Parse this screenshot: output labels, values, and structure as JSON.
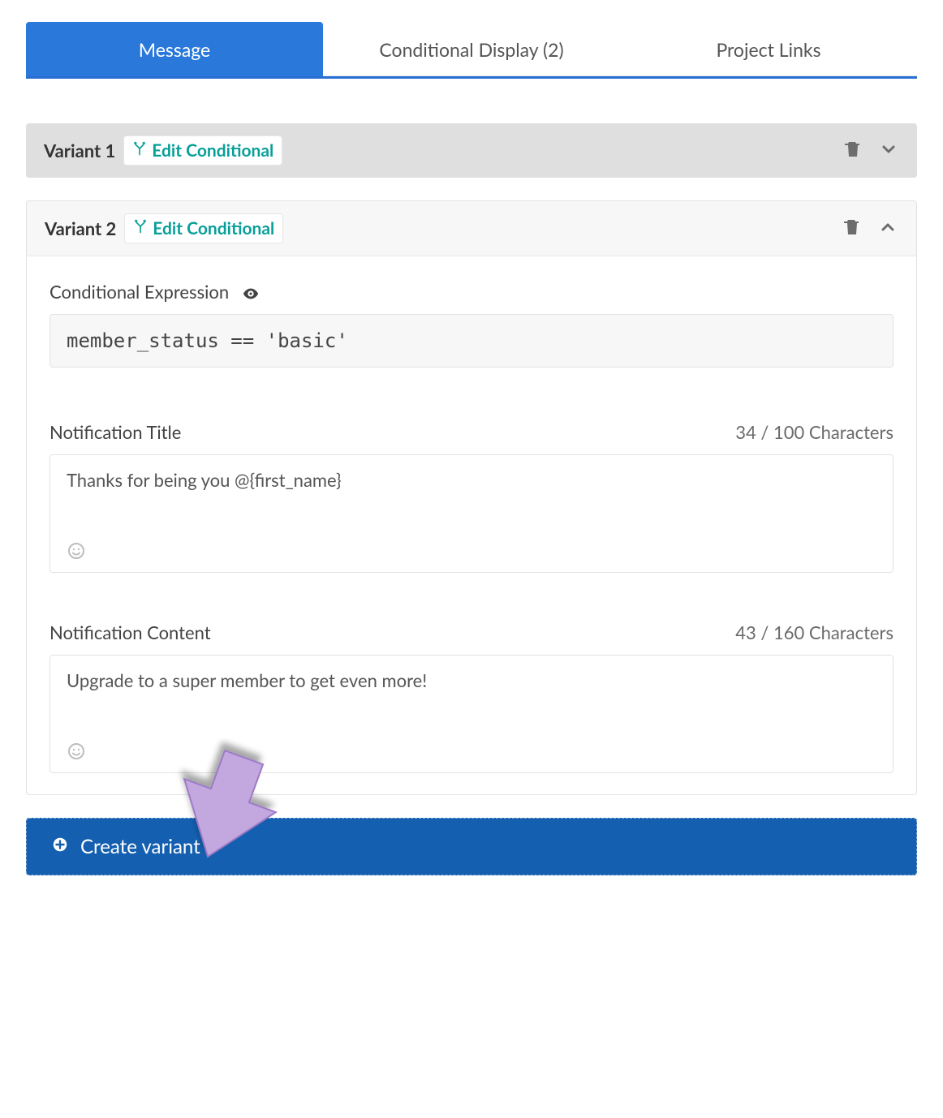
{
  "tabs": {
    "message": "Message",
    "conditional_display": "Conditional Display (2)",
    "project_links": "Project Links"
  },
  "variants": [
    {
      "title": "Variant 1",
      "edit_label": "Edit Conditional",
      "expanded": false
    },
    {
      "title": "Variant 2",
      "edit_label": "Edit Conditional",
      "expanded": true,
      "expr_label": "Conditional Expression",
      "expr_value": "member_status == 'basic'",
      "notif_title_label": "Notification Title",
      "notif_title_counter": "34 / 100 Characters",
      "notif_title_value": "Thanks for being you @{first_name}",
      "notif_content_label": "Notification Content",
      "notif_content_counter": "43 / 160 Characters",
      "notif_content_value": "Upgrade to a super member to get even more!"
    }
  ],
  "create_variant_label": "Create variant"
}
